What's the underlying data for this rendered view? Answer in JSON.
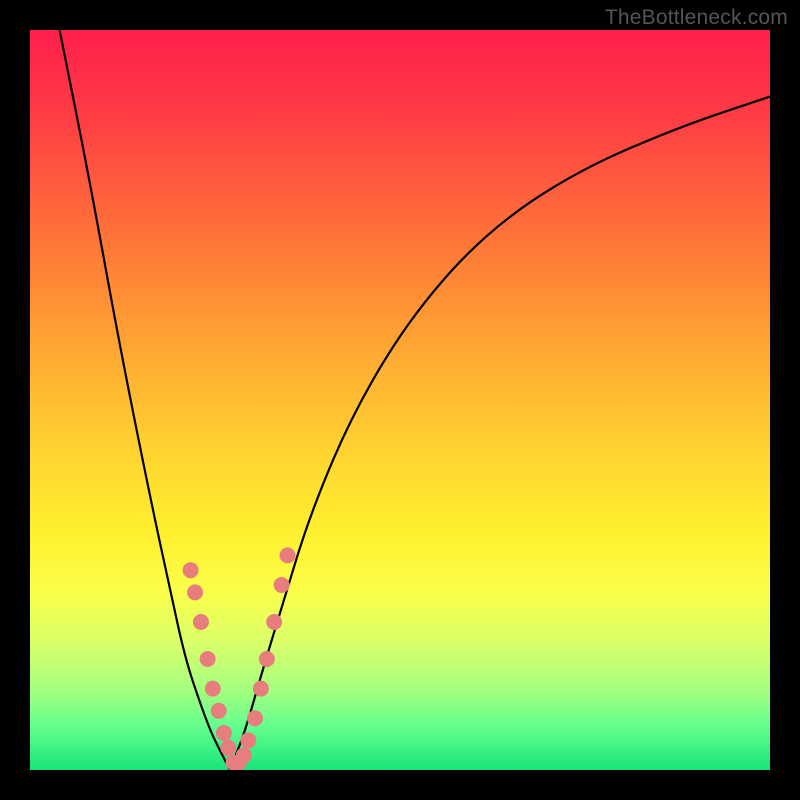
{
  "watermark": "TheBottleneck.com",
  "colors": {
    "frame": "#000000",
    "curve": "#000000",
    "marker": "#e77d7d",
    "gradient_top": "#ff1f4b",
    "gradient_bottom": "#18e57a"
  },
  "chart_data": {
    "type": "line",
    "title": "",
    "xlabel": "",
    "ylabel": "",
    "xlim": [
      0,
      100
    ],
    "ylim": [
      0,
      100
    ],
    "grid": false,
    "legend": false,
    "note": "Axes and ticks are not visible in the image; values are estimated on a normalized 0–100 scale from pixel positions.",
    "series": [
      {
        "name": "left-branch",
        "x": [
          4,
          8,
          12,
          16,
          19,
          21,
          23,
          24.5,
          26,
          27
        ],
        "y": [
          100,
          80,
          58,
          38,
          24,
          15,
          9,
          5,
          2,
          0
        ]
      },
      {
        "name": "right-branch",
        "x": [
          27,
          29,
          31,
          34,
          38,
          44,
          52,
          62,
          74,
          88,
          100
        ],
        "y": [
          0,
          5,
          12,
          22,
          35,
          49,
          62,
          73,
          81,
          87,
          91
        ]
      }
    ],
    "markers": {
      "name": "overlay-points",
      "x": [
        21.7,
        22.3,
        23.1,
        24.0,
        24.7,
        25.5,
        26.2,
        26.8,
        27.5,
        28.2,
        28.9,
        29.5,
        30.4,
        31.2,
        32.0,
        33.0,
        34.0,
        34.8
      ],
      "y": [
        27,
        24,
        20,
        15,
        11,
        8,
        5,
        3,
        1,
        1,
        2,
        4,
        7,
        11,
        15,
        20,
        25,
        29
      ]
    }
  }
}
